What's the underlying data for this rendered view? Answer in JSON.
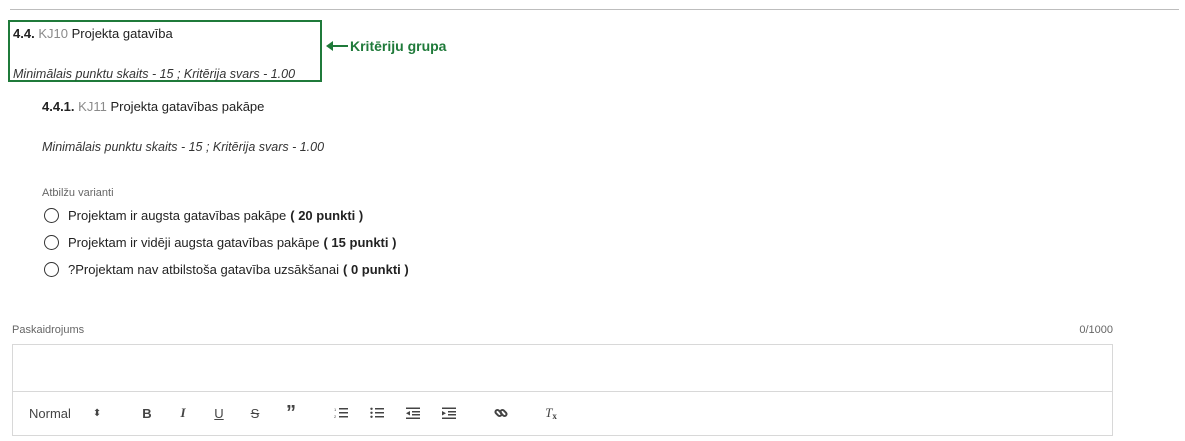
{
  "group": {
    "number": "4.4.",
    "code": "KJ10",
    "title": "Projekta gatavība",
    "meta": "Minimālais punktu skaits - 15 ; Kritērija svars - 1.00"
  },
  "annotation": {
    "label": "Kritēriju grupa",
    "color": "#1f7a3a"
  },
  "criterion": {
    "number": "4.4.1.",
    "code": "KJ11",
    "title": "Projekta gatavības pakāpe",
    "meta": "Minimālais punktu skaits - 15 ; Kritērija svars - 1.00"
  },
  "answers": {
    "label": "Atbilžu varianti",
    "options": [
      {
        "text": "Projektam ir augsta gatavības pakāpe",
        "points": "( 20 punkti )"
      },
      {
        "text": "Projektam ir vidēji augsta gatavības pakāpe",
        "points": "( 15 punkti )"
      },
      {
        "text": "?Projektam nav atbilstoša gatavība uzsākšanai",
        "points": "( 0 punkti )"
      }
    ]
  },
  "explanation": {
    "label": "Paskaidrojums",
    "counter": "0/1000",
    "text": ""
  },
  "toolbar": {
    "format": "Normal",
    "caret": "⬍",
    "bold": "B",
    "italic": "I",
    "underline": "U",
    "strike": "S",
    "quote": "”",
    "clear": "T"
  }
}
